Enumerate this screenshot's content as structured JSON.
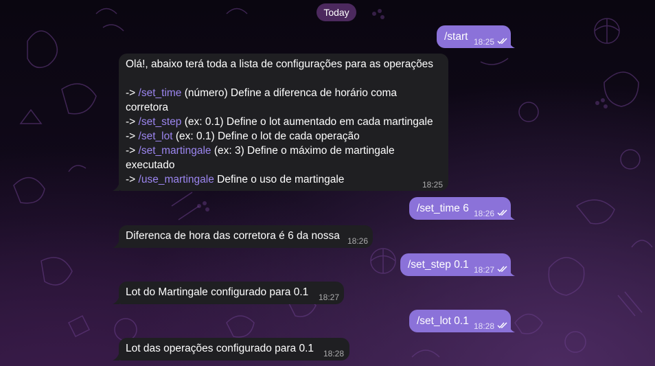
{
  "date_separator": "Today",
  "colors": {
    "incoming_bubble": "#1f1f22",
    "outgoing_bubble": "#8b72d9",
    "command_link": "#9c86f0",
    "date_pill": "#58306c"
  },
  "messages": [
    {
      "id": "m1",
      "direction": "out",
      "text": "/start",
      "time": "18:25",
      "status_icon": "double-check-icon"
    },
    {
      "id": "m2",
      "direction": "in",
      "intro": "Olá!, abaixo terá toda a lista de configurações para as operações",
      "lines": [
        {
          "prefix": "-> ",
          "command": "/set_time",
          "desc": " (número) Define a diferenca de horário coma"
        },
        {
          "prefix": "",
          "command": "",
          "desc": "corretora"
        },
        {
          "prefix": "-> ",
          "command": "/set_step",
          "desc": " (ex: 0.1) Define o lot aumentado em cada martingale"
        },
        {
          "prefix": "-> ",
          "command": "/set_lot",
          "desc": " (ex: 0.1) Define o lot de cada operação"
        },
        {
          "prefix": "-> ",
          "command": "/set_martingale",
          "desc": " (ex: 3) Define o máximo de martingale"
        },
        {
          "prefix": "",
          "command": "",
          "desc": "executado"
        },
        {
          "prefix": "-> ",
          "command": "/use_martingale",
          "desc": " Define o uso de martingale"
        }
      ],
      "time": "18:25"
    },
    {
      "id": "m3",
      "direction": "out",
      "text": "/set_time 6",
      "time": "18:26",
      "status_icon": "double-check-icon"
    },
    {
      "id": "m4",
      "direction": "in",
      "text": "Diferenca de hora das corretora é 6 da nossa",
      "time": "18:26"
    },
    {
      "id": "m5",
      "direction": "out",
      "text": "/set_step 0.1",
      "time": "18:27",
      "status_icon": "double-check-icon"
    },
    {
      "id": "m6",
      "direction": "in",
      "text": "Lot do Martingale configurado para 0.1",
      "time": "18:27"
    },
    {
      "id": "m7",
      "direction": "out",
      "text": "/set_lot 0.1",
      "time": "18:28",
      "status_icon": "double-check-icon"
    },
    {
      "id": "m8",
      "direction": "in",
      "text": "Lot das operações configurado para 0.1",
      "time": "18:28"
    }
  ]
}
